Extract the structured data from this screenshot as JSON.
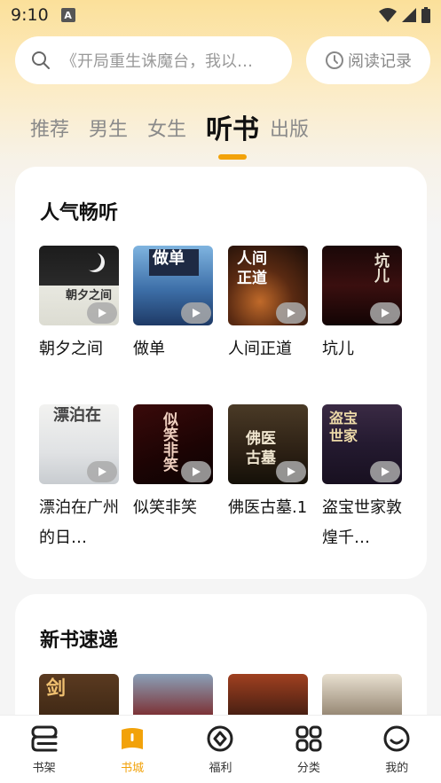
{
  "status_bar": {
    "time": "9:10",
    "notif_glyph": "A"
  },
  "search": {
    "placeholder": "《开局重生诛魔台，我以…"
  },
  "history": {
    "label": "阅读记录"
  },
  "tabs": [
    {
      "label": "推荐"
    },
    {
      "label": "男生"
    },
    {
      "label": "女生"
    },
    {
      "label": "听书",
      "active": true
    },
    {
      "label": "出版"
    }
  ],
  "popular": {
    "title": "人气畅听",
    "books": [
      {
        "title": "朝夕之间",
        "cover_text": "朝夕之间"
      },
      {
        "title": "做单",
        "cover_text": "做单"
      },
      {
        "title": "人间正道",
        "cover_text": "人间正道"
      },
      {
        "title": "坑儿",
        "cover_text": "坑儿"
      },
      {
        "title": "漂泊在广州的日…",
        "cover_text": "漂泊在"
      },
      {
        "title": "似笑非笑",
        "cover_text": "似笑非笑"
      },
      {
        "title": "佛医古墓.1",
        "cover_text": "佛医古墓"
      },
      {
        "title": "盗宝世家敦煌千…",
        "cover_text": "盗宝世家"
      }
    ]
  },
  "new_books": {
    "title": "新书速递",
    "books": [
      {
        "cover_text": "剑"
      },
      {
        "cover_text": ""
      },
      {
        "cover_text": ""
      },
      {
        "cover_text": ""
      }
    ]
  },
  "nav": [
    {
      "label": "书架",
      "icon": "bookshelf-icon"
    },
    {
      "label": "书城",
      "icon": "bookstore-icon",
      "active": true
    },
    {
      "label": "福利",
      "icon": "welfare-icon"
    },
    {
      "label": "分类",
      "icon": "category-icon"
    },
    {
      "label": "我的",
      "icon": "profile-icon"
    }
  ],
  "colors": {
    "accent": "#f2a20a",
    "header_gradient_top": "#fbe09a"
  }
}
